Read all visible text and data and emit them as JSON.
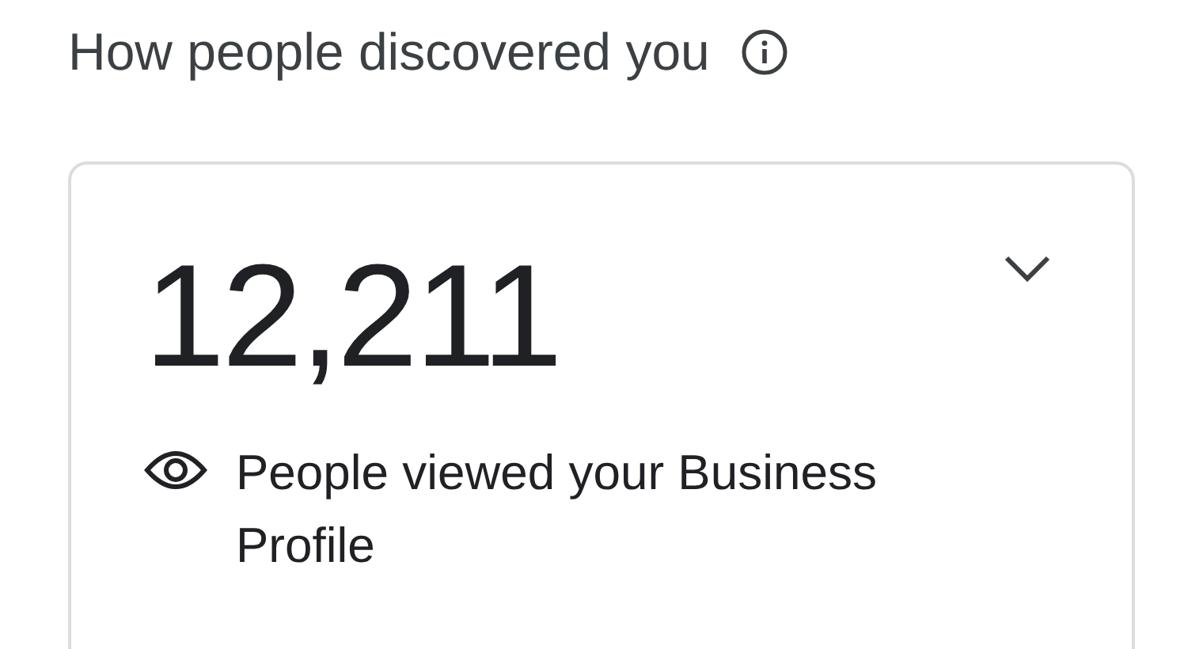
{
  "section": {
    "title": "How people discovered you"
  },
  "card": {
    "value": "12,211",
    "label": "People viewed your Business Profile",
    "expanded": false
  }
}
